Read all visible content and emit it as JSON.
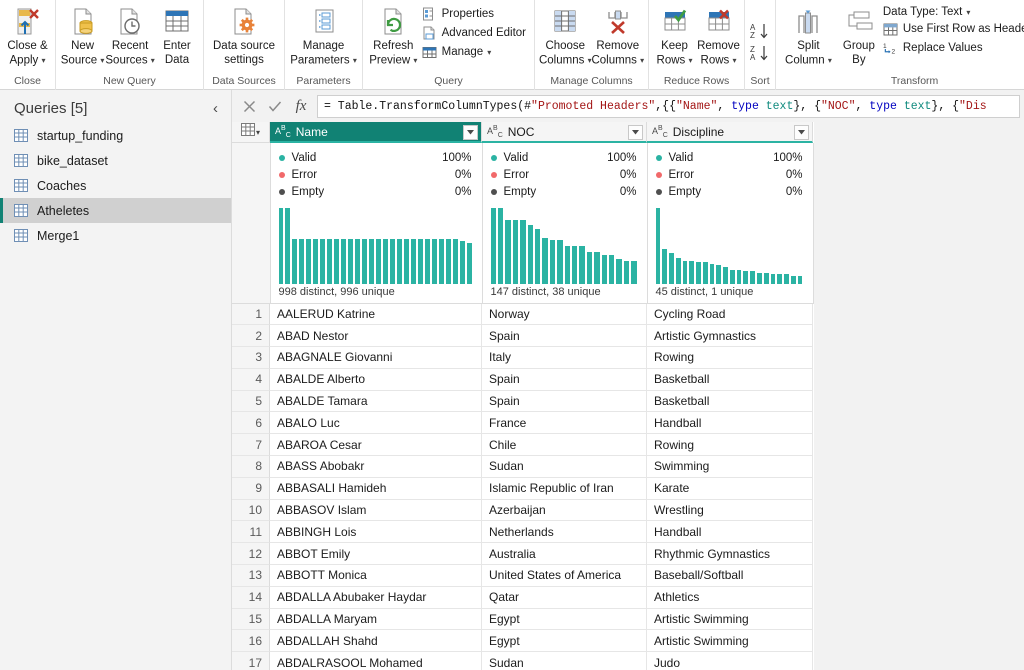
{
  "ribbon": {
    "groups": [
      {
        "label": "Close",
        "items": [
          {
            "label_line1": "Close &",
            "label_line2": "Apply",
            "icon": "close-apply-icon",
            "has_caret": true
          }
        ]
      },
      {
        "label": "New Query",
        "items": [
          {
            "label_line1": "New",
            "label_line2": "Source",
            "icon": "new-source-icon",
            "has_caret": true
          },
          {
            "label_line1": "Recent",
            "label_line2": "Sources",
            "icon": "recent-sources-icon",
            "has_caret": true
          },
          {
            "label_line1": "Enter",
            "label_line2": "Data",
            "icon": "enter-data-icon",
            "has_caret": false
          }
        ]
      },
      {
        "label": "Data Sources",
        "items": [
          {
            "label_line1": "Data source",
            "label_line2": "settings",
            "icon": "data-source-settings-icon",
            "has_caret": false
          }
        ]
      },
      {
        "label": "Parameters",
        "items": [
          {
            "label_line1": "Manage",
            "label_line2": "Parameters",
            "icon": "manage-parameters-icon",
            "has_caret": true
          }
        ]
      },
      {
        "label": "Query",
        "items": [
          {
            "label_line1": "Refresh",
            "label_line2": "Preview",
            "icon": "refresh-preview-icon",
            "has_caret": true
          }
        ],
        "small_items": [
          {
            "label": "Properties",
            "icon": "properties-icon",
            "has_caret": false
          },
          {
            "label": "Advanced Editor",
            "icon": "advanced-editor-icon",
            "has_caret": false
          },
          {
            "label": "Manage",
            "icon": "manage-icon",
            "has_caret": true
          }
        ]
      },
      {
        "label": "Manage Columns",
        "items": [
          {
            "label_line1": "Choose",
            "label_line2": "Columns",
            "icon": "choose-columns-icon",
            "has_caret": true
          },
          {
            "label_line1": "Remove",
            "label_line2": "Columns",
            "icon": "remove-columns-icon",
            "has_caret": true
          }
        ]
      },
      {
        "label": "Reduce Rows",
        "items": [
          {
            "label_line1": "Keep",
            "label_line2": "Rows",
            "icon": "keep-rows-icon",
            "has_caret": true
          },
          {
            "label_line1": "Remove",
            "label_line2": "Rows",
            "icon": "remove-rows-icon",
            "has_caret": true
          }
        ]
      },
      {
        "label": "Sort",
        "sort_items": [
          {
            "label": "sort-ascending",
            "icon": "sort-az-icon"
          },
          {
            "label": "sort-descending",
            "icon": "sort-za-icon"
          }
        ]
      },
      {
        "label": "Transform",
        "items": [
          {
            "label_line1": "Split",
            "label_line2": "Column",
            "icon": "split-column-icon",
            "has_caret": true
          },
          {
            "label_line1": "Group",
            "label_line2": "By",
            "icon": "group-by-icon",
            "has_caret": false
          }
        ],
        "small_items": [
          {
            "label": "Data Type: Text",
            "icon": "data-type-icon",
            "has_caret": true
          },
          {
            "label": "Use First Row as Headers",
            "icon": "use-first-row-icon",
            "has_caret": true
          },
          {
            "label": "Replace Values",
            "icon": "replace-values-icon",
            "has_caret": false
          }
        ]
      }
    ]
  },
  "queries": {
    "title": "Queries [5]",
    "collapse_icon": "chevron-left-icon",
    "items": [
      {
        "label": "startup_funding",
        "selected": false
      },
      {
        "label": "bike_dataset",
        "selected": false
      },
      {
        "label": "Coaches",
        "selected": false
      },
      {
        "label": "Atheletes",
        "selected": true
      },
      {
        "label": "Merge1",
        "selected": false
      }
    ]
  },
  "formula_bar": {
    "cancel_icon": "cancel-icon",
    "accept_icon": "checkmark-icon",
    "fx_label": "fx",
    "formula_prefix": "= Table.TransformColumnTypes(#",
    "formula_tokens": [
      {
        "t": "plain",
        "v": "= Table.TransformColumnTypes(#"
      },
      {
        "t": "str",
        "v": "\"Promoted Headers\""
      },
      {
        "t": "plain",
        "v": ",{{"
      },
      {
        "t": "str",
        "v": "\"Name\""
      },
      {
        "t": "plain",
        "v": ", "
      },
      {
        "t": "kw",
        "v": "type"
      },
      {
        "t": "plain",
        "v": " "
      },
      {
        "t": "type",
        "v": "text"
      },
      {
        "t": "plain",
        "v": "}, {"
      },
      {
        "t": "str",
        "v": "\"NOC\""
      },
      {
        "t": "plain",
        "v": ", "
      },
      {
        "t": "kw",
        "v": "type"
      },
      {
        "t": "plain",
        "v": " "
      },
      {
        "t": "type",
        "v": "text"
      },
      {
        "t": "plain",
        "v": "}, {"
      },
      {
        "t": "str",
        "v": "\"Dis"
      }
    ]
  },
  "grid": {
    "select_all_icon": "select-all-table-icon",
    "columns": [
      {
        "name": "Name",
        "type_icon": "abc-text-type-icon",
        "selected": true,
        "dropdown_icon": "filter-dropdown-icon",
        "quality": {
          "valid_label": "Valid",
          "valid_pct": "100%",
          "error_label": "Error",
          "error_pct": "0%",
          "empty_label": "Empty",
          "empty_pct": "0%",
          "footer": "998 distinct, 996 unique",
          "histogram": [
            96,
            96,
            56,
            56,
            56,
            56,
            56,
            56,
            56,
            56,
            56,
            56,
            56,
            56,
            56,
            56,
            56,
            56,
            56,
            56,
            56,
            56,
            56,
            56,
            56,
            56,
            54,
            52
          ]
        }
      },
      {
        "name": "NOC",
        "type_icon": "abc-text-type-icon",
        "selected": false,
        "dropdown_icon": "filter-dropdown-icon",
        "quality": {
          "valid_label": "Valid",
          "valid_pct": "100%",
          "error_label": "Error",
          "error_pct": "0%",
          "empty_label": "Empty",
          "empty_pct": "0%",
          "footer": "147 distinct, 38 unique",
          "histogram": [
            100,
            100,
            84,
            84,
            84,
            78,
            72,
            60,
            58,
            58,
            50,
            50,
            50,
            42,
            42,
            38,
            38,
            32,
            30,
            30
          ]
        }
      },
      {
        "name": "Discipline",
        "type_icon": "abc-text-type-icon",
        "selected": false,
        "dropdown_icon": "filter-dropdown-icon",
        "quality": {
          "valid_label": "Valid",
          "valid_pct": "100%",
          "error_label": "Error",
          "error_pct": "0%",
          "empty_label": "Empty",
          "empty_pct": "0%",
          "footer": "45 distinct, 1 unique",
          "histogram": [
            100,
            46,
            40,
            34,
            30,
            30,
            28,
            28,
            26,
            24,
            22,
            18,
            18,
            16,
            16,
            14,
            14,
            12,
            12,
            12,
            10,
            10
          ]
        }
      }
    ],
    "colors": {
      "valid_dot": "#2bb3a3",
      "error_dot": "#f1696a",
      "empty_dot": "#4f4f4f",
      "bar": "#2bb3a3",
      "selected_header_bg": "#118274",
      "accent_underline": "#2bb3a3"
    },
    "rows": [
      {
        "n": "1",
        "Name": "AALERUD Katrine",
        "NOC": "Norway",
        "Discipline": "Cycling Road"
      },
      {
        "n": "2",
        "Name": "ABAD Nestor",
        "NOC": "Spain",
        "Discipline": "Artistic Gymnastics"
      },
      {
        "n": "3",
        "Name": "ABAGNALE Giovanni",
        "NOC": "Italy",
        "Discipline": "Rowing"
      },
      {
        "n": "4",
        "Name": "ABALDE Alberto",
        "NOC": "Spain",
        "Discipline": "Basketball"
      },
      {
        "n": "5",
        "Name": "ABALDE Tamara",
        "NOC": "Spain",
        "Discipline": "Basketball"
      },
      {
        "n": "6",
        "Name": "ABALO Luc",
        "NOC": "France",
        "Discipline": "Handball"
      },
      {
        "n": "7",
        "Name": "ABAROA Cesar",
        "NOC": "Chile",
        "Discipline": "Rowing"
      },
      {
        "n": "8",
        "Name": "ABASS Abobakr",
        "NOC": "Sudan",
        "Discipline": "Swimming"
      },
      {
        "n": "9",
        "Name": "ABBASALI Hamideh",
        "NOC": "Islamic Republic of Iran",
        "Discipline": "Karate"
      },
      {
        "n": "10",
        "Name": "ABBASOV Islam",
        "NOC": "Azerbaijan",
        "Discipline": "Wrestling"
      },
      {
        "n": "11",
        "Name": "ABBINGH Lois",
        "NOC": "Netherlands",
        "Discipline": "Handball"
      },
      {
        "n": "12",
        "Name": "ABBOT Emily",
        "NOC": "Australia",
        "Discipline": "Rhythmic Gymnastics"
      },
      {
        "n": "13",
        "Name": "ABBOTT Monica",
        "NOC": "United States of America",
        "Discipline": "Baseball/Softball"
      },
      {
        "n": "14",
        "Name": "ABDALLA Abubaker Haydar",
        "NOC": "Qatar",
        "Discipline": "Athletics"
      },
      {
        "n": "15",
        "Name": "ABDALLA Maryam",
        "NOC": "Egypt",
        "Discipline": "Artistic Swimming"
      },
      {
        "n": "16",
        "Name": "ABDALLAH Shahd",
        "NOC": "Egypt",
        "Discipline": "Artistic Swimming"
      },
      {
        "n": "17",
        "Name": "ABDALRASOOL Mohamed",
        "NOC": "Sudan",
        "Discipline": "Judo"
      }
    ]
  }
}
